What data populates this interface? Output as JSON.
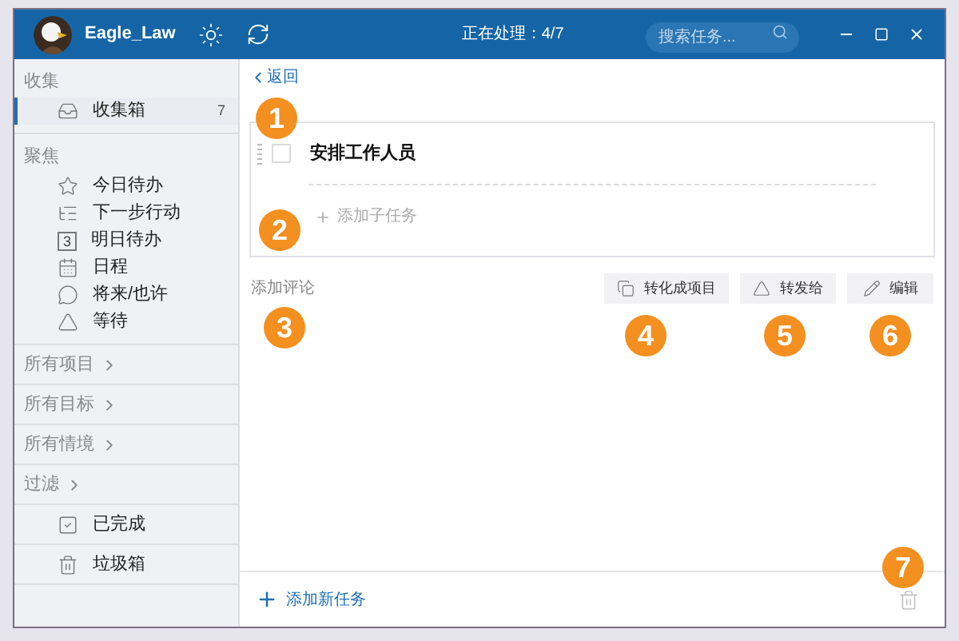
{
  "title_bar": {
    "user": "Eagle_Law",
    "status": "正在处理：4/7",
    "search": {
      "placeholder": "搜索任务..."
    }
  },
  "sidebar": [
    {
      "kind": "header",
      "label": "收集"
    },
    {
      "kind": "item",
      "label": "收集箱",
      "count": "7",
      "selected": true
    },
    {
      "kind": "header",
      "label": "聚焦"
    },
    {
      "kind": "item",
      "label": "今日待办",
      "selected": false
    },
    {
      "kind": "item",
      "label": "下一步行动",
      "selected": false
    },
    {
      "kind": "item",
      "label": "明日待办",
      "icon_text": "3",
      "selected": false
    },
    {
      "kind": "item",
      "label": "日程",
      "selected": false
    },
    {
      "kind": "item",
      "label": "将来/也许",
      "selected": false
    },
    {
      "kind": "item",
      "label": "等待",
      "selected": false
    },
    {
      "kind": "group",
      "label": "所有项目"
    },
    {
      "kind": "group",
      "label": "所有目标"
    },
    {
      "kind": "group",
      "label": "所有情境"
    },
    {
      "kind": "group",
      "label": "过滤"
    },
    {
      "kind": "item",
      "label": "已完成",
      "selected": false
    },
    {
      "kind": "item",
      "label": "垃圾箱",
      "selected": false
    }
  ],
  "main": {
    "back": "返回",
    "task": {
      "title": "安排工作人员",
      "checked": false,
      "add_subtask": "添加子任务"
    },
    "add_comment": "添加评论",
    "actions": [
      "转化成项目",
      "转发给",
      "编辑"
    ],
    "add_task": "添加新任务"
  },
  "callouts": [
    "1",
    "2",
    "3",
    "4",
    "5",
    "6",
    "7"
  ]
}
